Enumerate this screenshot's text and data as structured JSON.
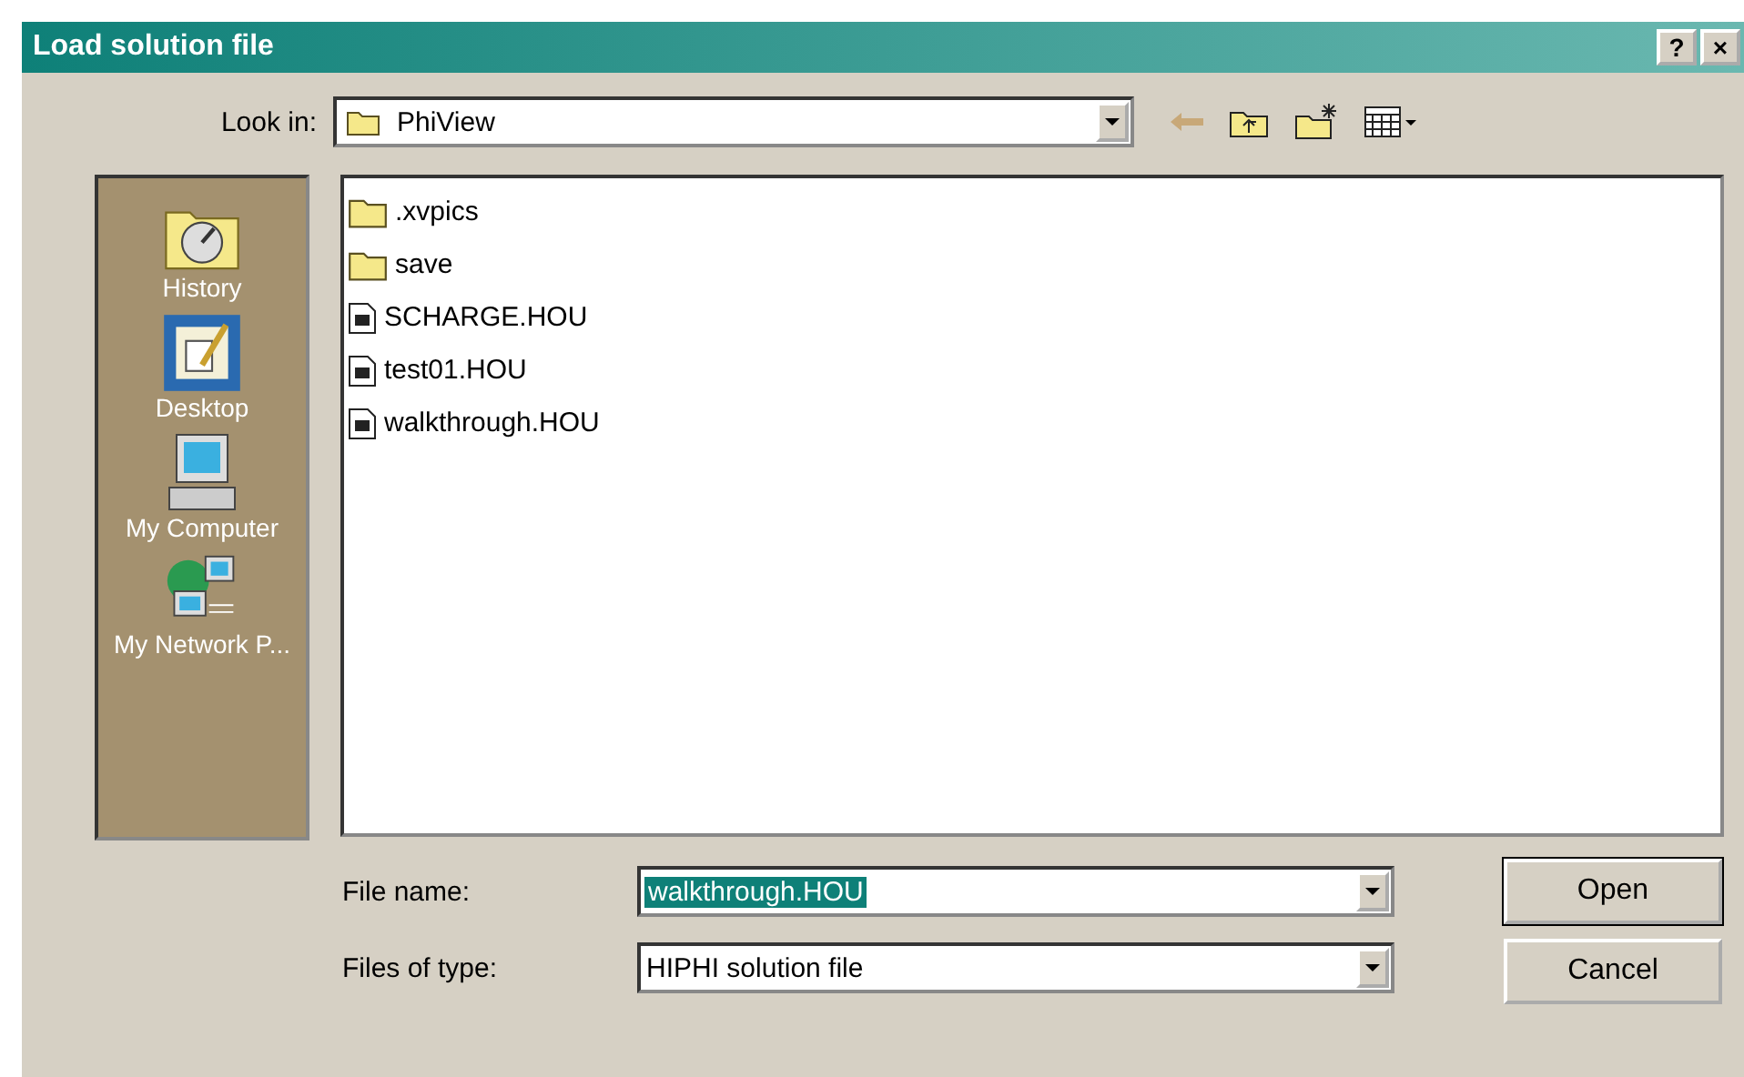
{
  "window": {
    "title": "Load solution file",
    "buttons": [
      "?",
      "×"
    ]
  },
  "look_in": {
    "label": "Look in:",
    "value": "PhiView"
  },
  "places": [
    {
      "kind": "history",
      "label": "History"
    },
    {
      "kind": "desktop",
      "label": "Desktop"
    },
    {
      "kind": "computer",
      "label": "My Computer"
    },
    {
      "kind": "network",
      "label": "My Network P..."
    }
  ],
  "files": [
    {
      "kind": "folder",
      "name": ".xvpics"
    },
    {
      "kind": "folder",
      "name": "save"
    },
    {
      "kind": "file",
      "name": "SCHARGE.HOU"
    },
    {
      "kind": "file",
      "name": "test01.HOU"
    },
    {
      "kind": "file",
      "name": "walkthrough.HOU"
    }
  ],
  "file_name": {
    "label": "File name:",
    "value": "walkthrough.HOU",
    "text_selected": true
  },
  "file_type": {
    "label": "Files of type:",
    "value": "HIPHI solution file"
  },
  "buttons": [
    {
      "label": "Open",
      "default": true
    },
    {
      "label": "Cancel",
      "default": false
    }
  ]
}
